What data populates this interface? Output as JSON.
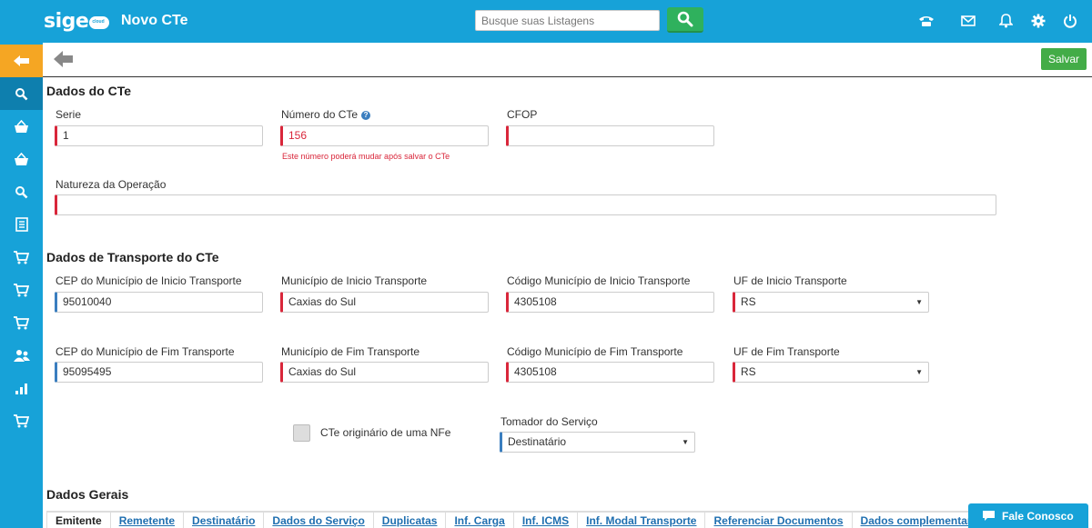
{
  "header": {
    "logo": "sige",
    "logo_badge": "cloud",
    "title": "Novo CTe",
    "search_placeholder": "Busque suas Listagens"
  },
  "toolbar": {
    "save_label": "Salvar"
  },
  "sections": {
    "dados_cte": "Dados do CTe",
    "transporte": "Dados de Transporte do CTe",
    "gerais": "Dados Gerais"
  },
  "cte": {
    "serie_label": "Serie",
    "serie_value": "1",
    "numero_label": "Número do CTe",
    "numero_value": "156",
    "numero_hint": "Este número poderá mudar após salvar o CTe",
    "cfop_label": "CFOP",
    "cfop_value": "",
    "natureza_label": "Natureza da Operação",
    "natureza_value": ""
  },
  "transporte": {
    "cep_inicio_label": "CEP do Município de Inicio Transporte",
    "cep_inicio_value": "95010040",
    "mun_inicio_label": "Município de Inicio Transporte",
    "mun_inicio_value": "Caxias do Sul",
    "cod_inicio_label": "Código Município de Inicio Transporte",
    "cod_inicio_value": "4305108",
    "uf_inicio_label": "UF de Inicio Transporte",
    "uf_inicio_value": "RS",
    "cep_fim_label": "CEP do Município de Fim Transporte",
    "cep_fim_value": "95095495",
    "mun_fim_label": "Município de Fim Transporte",
    "mun_fim_value": "Caxias do Sul",
    "cod_fim_label": "Código Município de Fim Transporte",
    "cod_fim_value": "4305108",
    "uf_fim_label": "UF de Fim Transporte",
    "uf_fim_value": "RS",
    "nfe_checkbox_label": "CTe originário de uma NFe",
    "tomador_label": "Tomador do Serviço",
    "tomador_value": "Destinatário"
  },
  "tabs": [
    "Emitente",
    "Remetente",
    "Destinatário",
    "Dados do Serviço",
    "Duplicatas",
    "Inf. Carga",
    "Inf. ICMS",
    "Inf. Modal Transporte",
    "Referenciar Documentos",
    "Dados complementares"
  ],
  "contact": {
    "label": "Fale Conosco"
  },
  "icons": {
    "top": [
      "phone-icon",
      "mail-icon",
      "bell-icon",
      "gear-icon",
      "power-icon"
    ],
    "sidebar": [
      "back-arrow-icon",
      "search-icon",
      "basket-icon",
      "basket-icon",
      "search-icon",
      "document-icon",
      "cart-icon",
      "cart-icon",
      "cart-icon",
      "users-icon",
      "bar-chart-icon",
      "cart-icon"
    ]
  },
  "colors": {
    "primary": "#17a2d8",
    "search_button": "#2fb15d",
    "save_button": "#43ac47",
    "required": "#d9263a",
    "optional": "#3a7ebf",
    "back_highlight": "#f5a623"
  }
}
